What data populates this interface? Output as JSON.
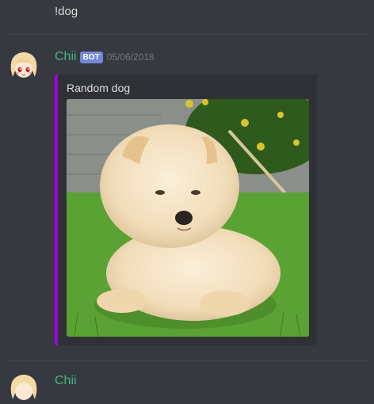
{
  "previous_message": {
    "content": "!dog"
  },
  "message": {
    "author": "Chii",
    "badge": "BOT",
    "timestamp": "05/06/2018",
    "embed": {
      "title": "Random dog",
      "accent_color": "#a100e6",
      "image_alt": "Fluffy cream chow chow puppy sitting on grass"
    }
  },
  "next_message": {
    "author": "Chii"
  },
  "colors": {
    "background": "#36393f",
    "username": "#43b581",
    "bot_badge": "#7289da",
    "embed_background": "#2f3136"
  }
}
